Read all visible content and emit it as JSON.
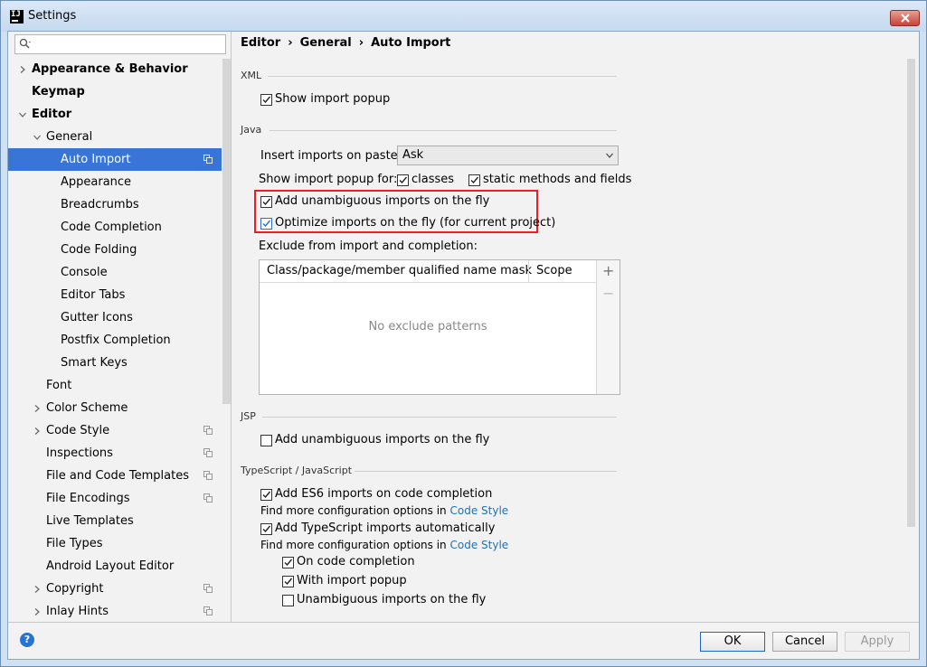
{
  "window": {
    "title": "Settings",
    "icon_text": "IJ"
  },
  "search": {
    "placeholder": ""
  },
  "sidebar": {
    "items": [
      {
        "label": "Appearance & Behavior",
        "bold": true,
        "arrow": "right",
        "indent": 0
      },
      {
        "label": "Keymap",
        "bold": true,
        "arrow": "",
        "indent": 0
      },
      {
        "label": "Editor",
        "bold": true,
        "arrow": "down",
        "indent": 0
      },
      {
        "label": "General",
        "bold": false,
        "arrow": "down",
        "indent": 1
      },
      {
        "label": "Auto Import",
        "bold": false,
        "arrow": "",
        "indent": 2,
        "selected": true,
        "copy": true
      },
      {
        "label": "Appearance",
        "bold": false,
        "arrow": "",
        "indent": 2
      },
      {
        "label": "Breadcrumbs",
        "bold": false,
        "arrow": "",
        "indent": 2
      },
      {
        "label": "Code Completion",
        "bold": false,
        "arrow": "",
        "indent": 2
      },
      {
        "label": "Code Folding",
        "bold": false,
        "arrow": "",
        "indent": 2
      },
      {
        "label": "Console",
        "bold": false,
        "arrow": "",
        "indent": 2
      },
      {
        "label": "Editor Tabs",
        "bold": false,
        "arrow": "",
        "indent": 2
      },
      {
        "label": "Gutter Icons",
        "bold": false,
        "arrow": "",
        "indent": 2
      },
      {
        "label": "Postfix Completion",
        "bold": false,
        "arrow": "",
        "indent": 2
      },
      {
        "label": "Smart Keys",
        "bold": false,
        "arrow": "",
        "indent": 2
      },
      {
        "label": "Font",
        "bold": false,
        "arrow": "",
        "indent": 1
      },
      {
        "label": "Color Scheme",
        "bold": false,
        "arrow": "right",
        "indent": 1
      },
      {
        "label": "Code Style",
        "bold": false,
        "arrow": "right",
        "indent": 1,
        "copy": true
      },
      {
        "label": "Inspections",
        "bold": false,
        "arrow": "",
        "indent": 1,
        "copy": true
      },
      {
        "label": "File and Code Templates",
        "bold": false,
        "arrow": "",
        "indent": 1,
        "copy": true
      },
      {
        "label": "File Encodings",
        "bold": false,
        "arrow": "",
        "indent": 1,
        "copy": true
      },
      {
        "label": "Live Templates",
        "bold": false,
        "arrow": "",
        "indent": 1
      },
      {
        "label": "File Types",
        "bold": false,
        "arrow": "",
        "indent": 1
      },
      {
        "label": "Android Layout Editor",
        "bold": false,
        "arrow": "",
        "indent": 1
      },
      {
        "label": "Copyright",
        "bold": false,
        "arrow": "right",
        "indent": 1,
        "copy": true
      },
      {
        "label": "Inlay Hints",
        "bold": false,
        "arrow": "right",
        "indent": 1,
        "copy": true
      }
    ]
  },
  "breadcrumb": {
    "editor": "Editor",
    "general": "General",
    "page": "Auto Import",
    "sep": "›"
  },
  "xml": {
    "section": "XML",
    "show_import_popup": "Show import popup",
    "show_import_popup_checked": true
  },
  "java": {
    "section": "Java",
    "insert_imports_label": "Insert imports on paste:",
    "insert_imports_value": "Ask",
    "show_popup_for_label": "Show import popup for:",
    "classes_label": "classes",
    "classes_checked": true,
    "static_label": "static methods and fields",
    "static_checked": true,
    "add_unambiguous": "Add unambiguous imports on the fly",
    "add_unambiguous_checked": true,
    "optimize_imports": "Optimize imports on the fly (for current project)",
    "optimize_imports_checked": true,
    "exclude_label": "Exclude from import and completion:",
    "table": {
      "col_mask": "Class/package/member qualified name mask",
      "col_scope": "Scope",
      "empty": "No exclude patterns",
      "add": "+",
      "remove": "−"
    }
  },
  "jsp": {
    "section": "JSP",
    "add_unambiguous": "Add unambiguous imports on the fly",
    "checked": false
  },
  "ts": {
    "section": "TypeScript / JavaScript",
    "es6": "Add ES6 imports on code completion",
    "es6_checked": true,
    "find_more_1": "Find more configuration options in ",
    "code_style_1": "Code Style",
    "ts_auto": "Add TypeScript imports automatically",
    "ts_auto_checked": true,
    "find_more_2": "Find more configuration options in ",
    "code_style_2": "Code Style",
    "on_code_completion": "On code completion",
    "on_code_completion_checked": true,
    "with_import_popup": "With import popup",
    "with_import_popup_checked": true,
    "unambiguous": "Unambiguous imports on the fly",
    "unambiguous_checked": false
  },
  "footer": {
    "help": "?",
    "ok": "OK",
    "cancel": "Cancel",
    "apply": "Apply"
  },
  "colors": {
    "selection": "#3875d7",
    "link": "#2470b3",
    "highlight_box": "#e81f25",
    "close": "#c7433a"
  }
}
